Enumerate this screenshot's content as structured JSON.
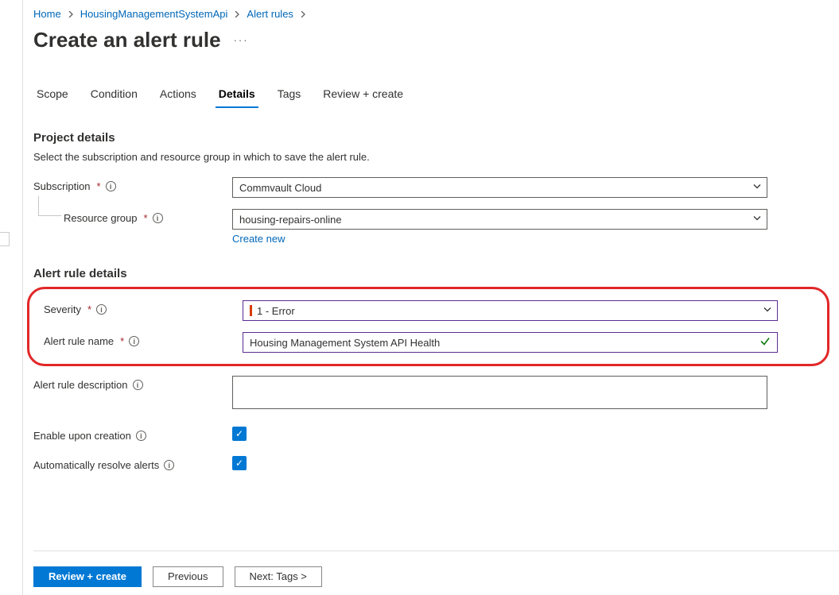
{
  "breadcrumb": {
    "items": [
      {
        "label": "Home"
      },
      {
        "label": "HousingManagementSystemApi"
      },
      {
        "label": "Alert rules"
      }
    ]
  },
  "title": "Create an alert rule",
  "tabs": {
    "items": [
      {
        "label": "Scope"
      },
      {
        "label": "Condition"
      },
      {
        "label": "Actions"
      },
      {
        "label": "Details"
      },
      {
        "label": "Tags"
      },
      {
        "label": "Review + create"
      }
    ],
    "active_index": 3
  },
  "project": {
    "heading": "Project details",
    "desc": "Select the subscription and resource group in which to save the alert rule.",
    "subscription_label": "Subscription",
    "subscription_value": "Commvault Cloud",
    "resource_group_label": "Resource group",
    "resource_group_value": "housing-repairs-online",
    "create_new": "Create new"
  },
  "alert": {
    "heading": "Alert rule details",
    "severity_label": "Severity",
    "severity_value": "1 - Error",
    "name_label": "Alert rule name",
    "name_value": "Housing Management System API Health",
    "desc_label": "Alert rule description",
    "enable_label": "Enable upon creation",
    "autoresolve_label": "Automatically resolve alerts"
  },
  "footer": {
    "review": "Review + create",
    "previous": "Previous",
    "next": "Next: Tags >"
  }
}
